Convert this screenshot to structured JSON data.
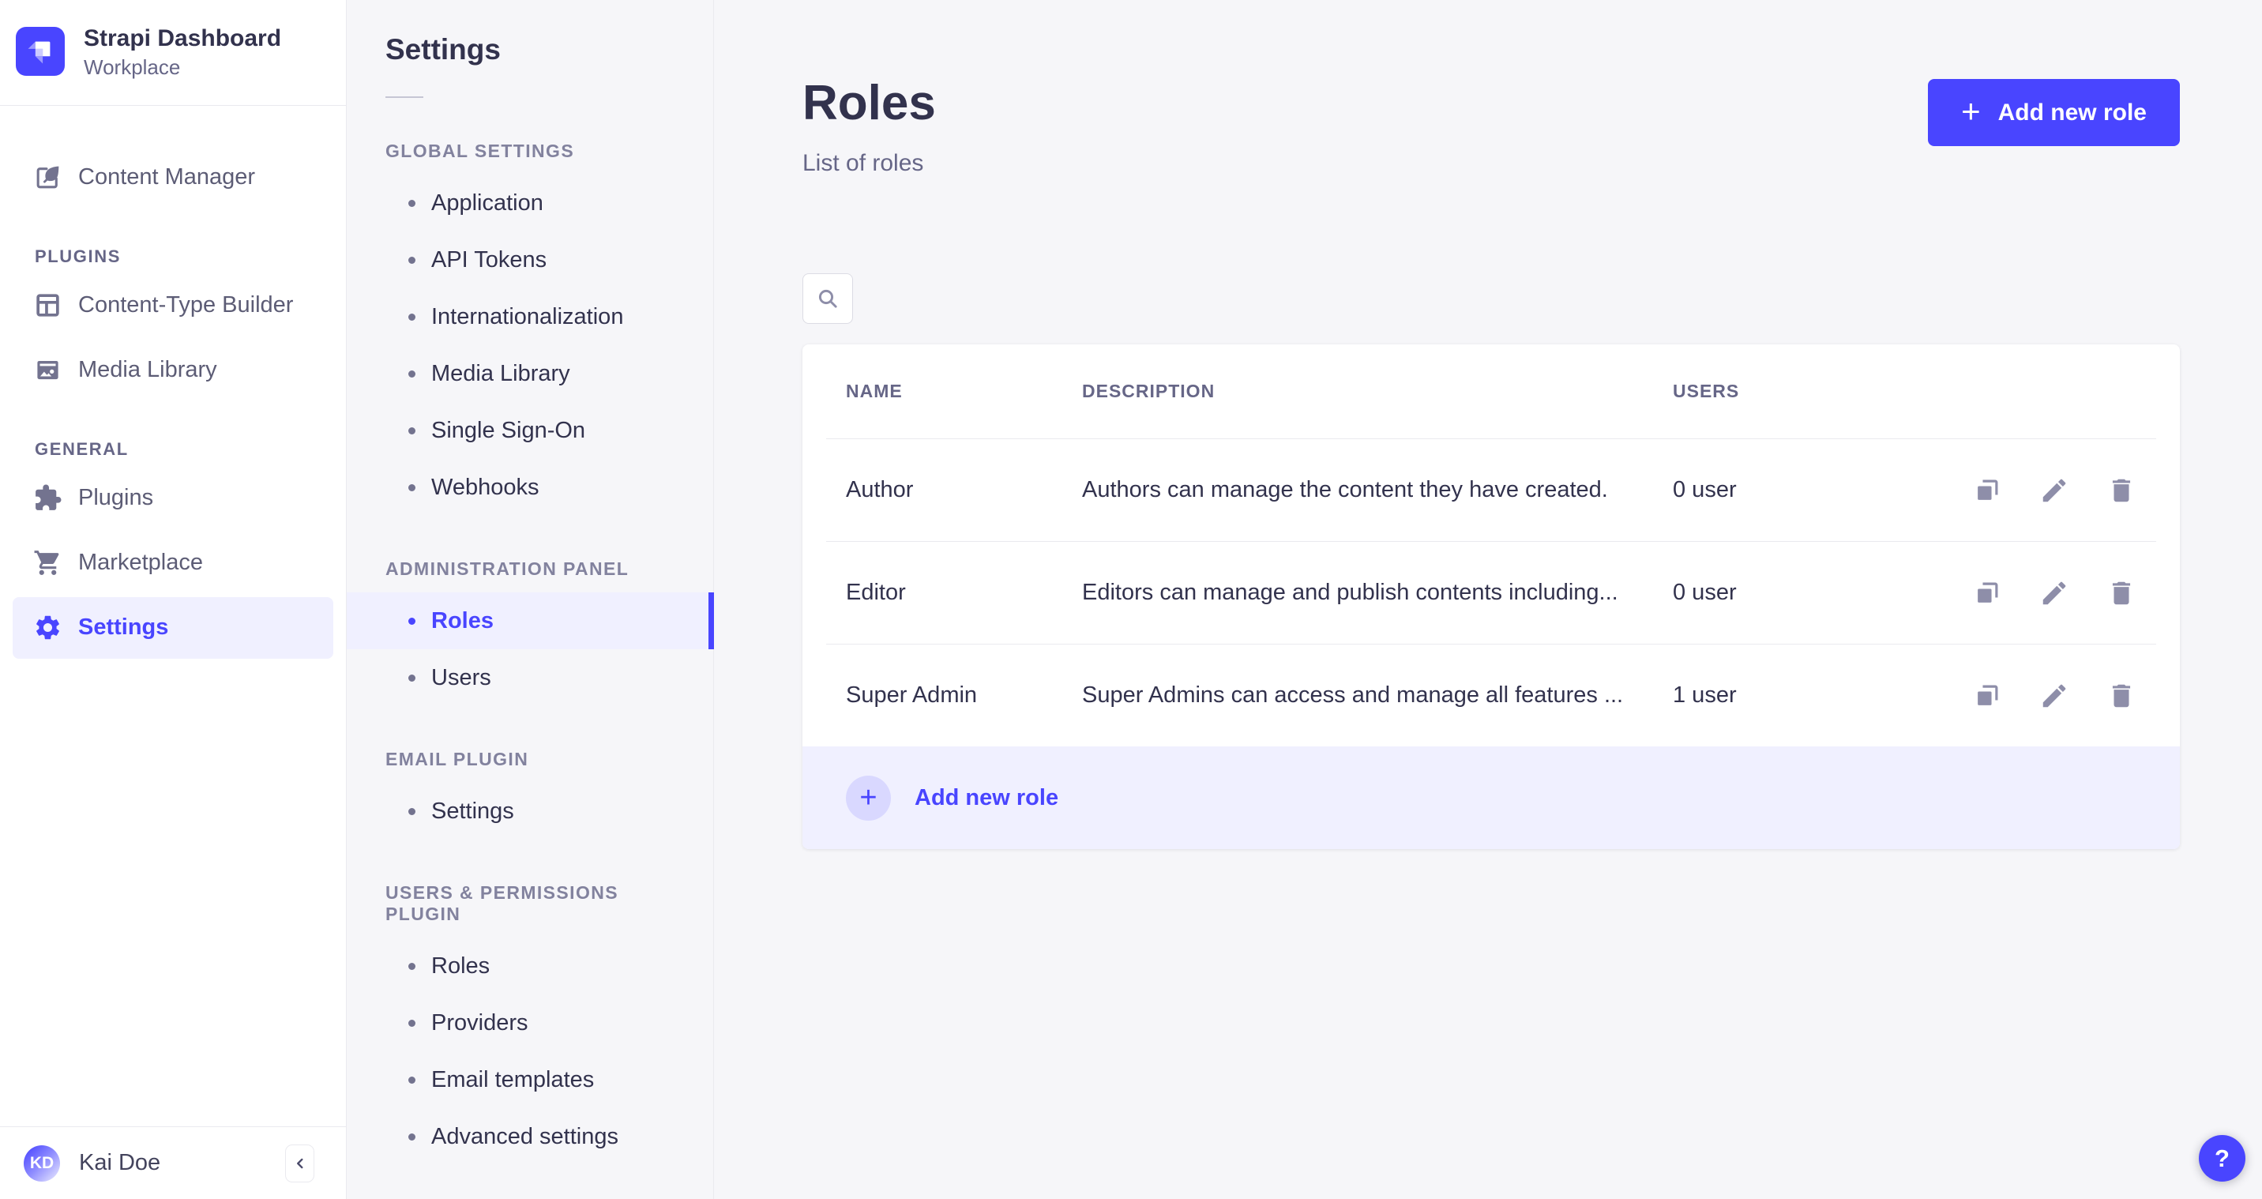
{
  "colors": {
    "primary": "#4945ff",
    "primary_light_bg": "#f0f0ff",
    "text_dark": "#32324d",
    "text_mid": "#666687",
    "border": "#eaeaef",
    "page_bg": "#f6f6f9"
  },
  "brand": {
    "title": "Strapi Dashboard",
    "workspace": "Workplace"
  },
  "sidebar": {
    "top_items": [
      {
        "label": "Content Manager",
        "icon": "feather-icon",
        "active": false
      }
    ],
    "sections": [
      {
        "label": "PLUGINS",
        "items": [
          {
            "label": "Content-Type Builder",
            "icon": "layout-icon",
            "active": false
          },
          {
            "label": "Media Library",
            "icon": "image-icon",
            "active": false
          }
        ]
      },
      {
        "label": "GENERAL",
        "items": [
          {
            "label": "Plugins",
            "icon": "puzzle-icon",
            "active": false
          },
          {
            "label": "Marketplace",
            "icon": "cart-icon",
            "active": false
          },
          {
            "label": "Settings",
            "icon": "gear-icon",
            "active": true
          }
        ]
      }
    ],
    "user": {
      "initials": "KD",
      "name": "Kai Doe"
    }
  },
  "subnav": {
    "title": "Settings",
    "sections": [
      {
        "label": "GLOBAL SETTINGS",
        "items": [
          {
            "label": "Application",
            "active": false
          },
          {
            "label": "API Tokens",
            "active": false
          },
          {
            "label": "Internationalization",
            "active": false
          },
          {
            "label": "Media Library",
            "active": false
          },
          {
            "label": "Single Sign-On",
            "active": false
          },
          {
            "label": "Webhooks",
            "active": false
          }
        ]
      },
      {
        "label": "ADMINISTRATION PANEL",
        "items": [
          {
            "label": "Roles",
            "active": true
          },
          {
            "label": "Users",
            "active": false
          }
        ]
      },
      {
        "label": "EMAIL PLUGIN",
        "items": [
          {
            "label": "Settings",
            "active": false
          }
        ]
      },
      {
        "label": "USERS & PERMISSIONS PLUGIN",
        "items": [
          {
            "label": "Roles",
            "active": false
          },
          {
            "label": "Providers",
            "active": false
          },
          {
            "label": "Email templates",
            "active": false
          },
          {
            "label": "Advanced settings",
            "active": false
          }
        ]
      }
    ]
  },
  "main": {
    "title": "Roles",
    "subtitle": "List of roles",
    "add_button": {
      "label": "Add new role",
      "icon": "plus-icon"
    },
    "search": {
      "icon": "search-icon"
    },
    "table": {
      "columns": [
        "NAME",
        "DESCRIPTION",
        "USERS"
      ],
      "rows": [
        {
          "name": "Author",
          "description": "Authors can manage the content they have created.",
          "users": "0 user"
        },
        {
          "name": "Editor",
          "description": "Editors can manage and publish contents including...",
          "users": "0 user"
        },
        {
          "name": "Super Admin",
          "description": "Super Admins can access and manage all features ...",
          "users": "1 user"
        }
      ],
      "actions": [
        "duplicate",
        "edit",
        "delete"
      ],
      "footer": {
        "label": "Add new role"
      }
    }
  },
  "help": {
    "label": "?"
  }
}
